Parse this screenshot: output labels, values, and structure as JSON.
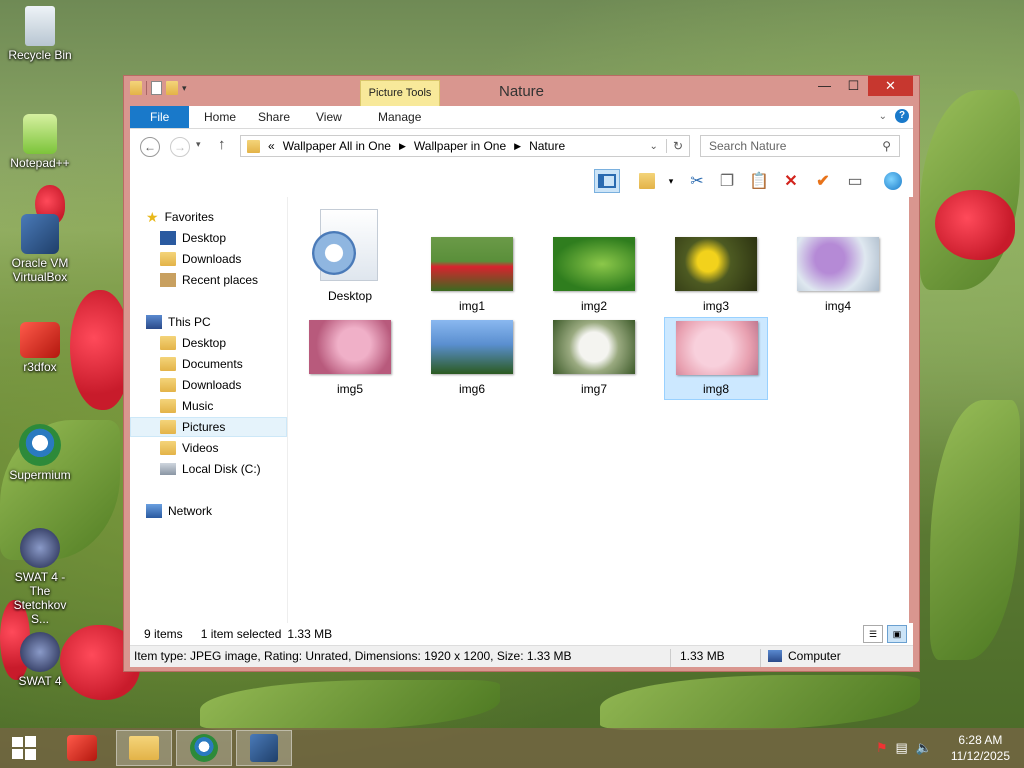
{
  "desktop": {
    "icons": [
      {
        "label": "Recycle Bin"
      },
      {
        "label": "Notepad++"
      },
      {
        "label": "Oracle VM VirtualBox"
      },
      {
        "label": "r3dfox"
      },
      {
        "label": "Supermium"
      },
      {
        "label": "SWAT 4 - The Stetchkov S..."
      },
      {
        "label": "SWAT 4"
      }
    ]
  },
  "window": {
    "title": "Nature",
    "contextual_tab_group": "Picture Tools",
    "ribbon_tabs": [
      "File",
      "Home",
      "Share",
      "View",
      "Manage"
    ],
    "address": {
      "prefix": "«",
      "segments": [
        "Wallpaper All in One",
        "Wallpaper in One",
        "Nature"
      ]
    },
    "search": {
      "placeholder": "Search Nature"
    },
    "nav": {
      "favorites": "Favorites",
      "favorites_items": [
        "Desktop",
        "Downloads",
        "Recent places"
      ],
      "this_pc": "This PC",
      "this_pc_items": [
        "Desktop",
        "Documents",
        "Downloads",
        "Music",
        "Pictures",
        "Videos",
        "Local Disk (C:)"
      ],
      "network": "Network",
      "selected": "Pictures"
    },
    "items": [
      {
        "name": "Desktop",
        "kind": "settings-file"
      },
      {
        "name": "img1",
        "colors": [
          "#5a8f3a",
          "#d8232e"
        ]
      },
      {
        "name": "img2",
        "colors": [
          "#2f7d1e",
          "#8cc84a"
        ]
      },
      {
        "name": "img3",
        "colors": [
          "#4d5a22",
          "#f2d21c"
        ]
      },
      {
        "name": "img4",
        "colors": [
          "#dfe8f0",
          "#b58ad6"
        ]
      },
      {
        "name": "img5",
        "colors": [
          "#b85a7c",
          "#f0b0c8"
        ]
      },
      {
        "name": "img6",
        "colors": [
          "#5a8fd0",
          "#2b5a20"
        ]
      },
      {
        "name": "img7",
        "colors": [
          "#3d5a2a",
          "#f4f4f0"
        ]
      },
      {
        "name": "img8",
        "colors": [
          "#e8a0b0",
          "#f8d0dc"
        ]
      }
    ],
    "selected_item": "img8",
    "status": {
      "item_count": "9 items",
      "selection": "1 item selected",
      "selection_size": "1.33 MB",
      "details": "Item type: JPEG image, Rating: Unrated, Dimensions: 1920 x 1200, Size: 1.33 MB",
      "size": "1.33 MB",
      "location": "Computer"
    }
  },
  "taskbar": {
    "time": "6:28 AM",
    "date": "11/12/2025"
  },
  "colors": {
    "window_frame": "#d9968f",
    "accent": "#1979ca",
    "close": "#c7372f",
    "selection": "#cce8ff"
  }
}
